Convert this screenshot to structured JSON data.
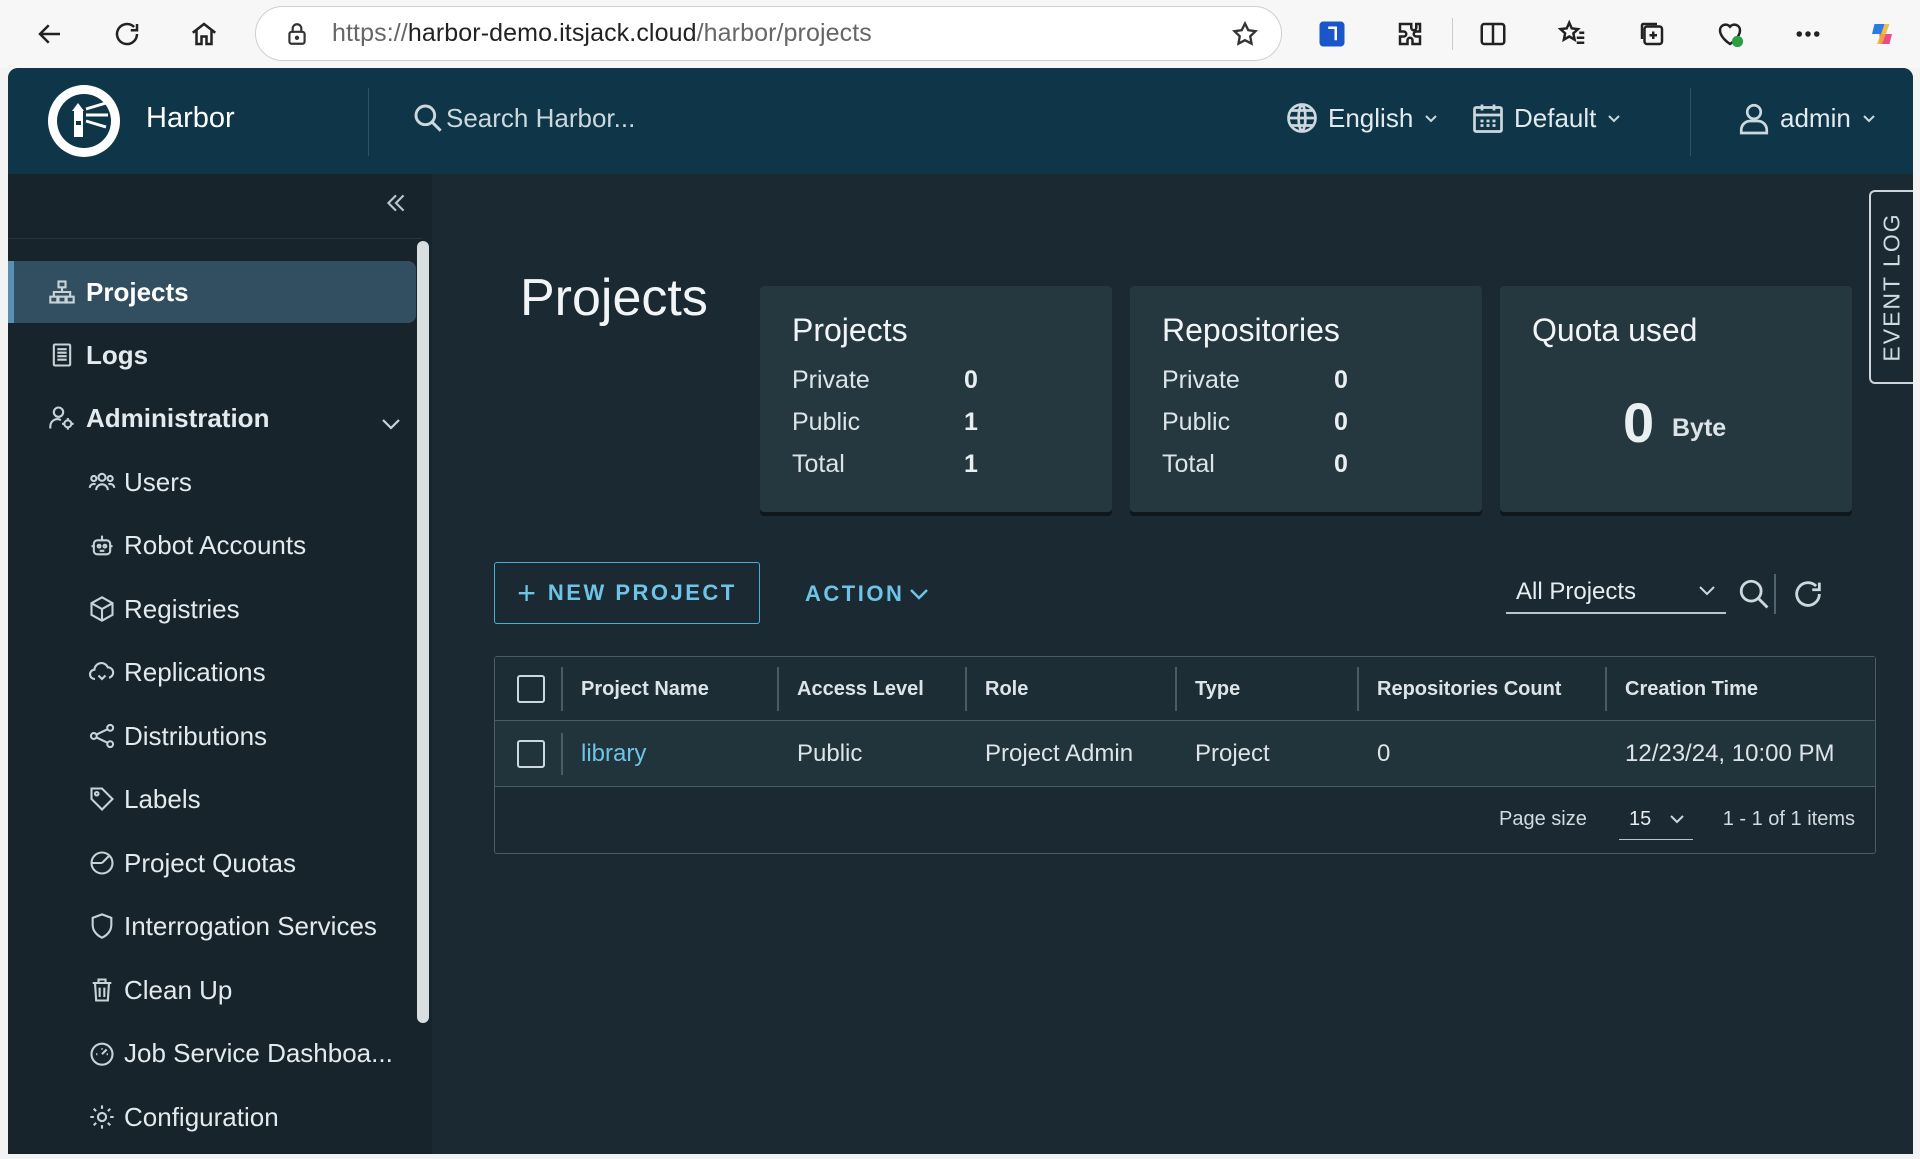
{
  "browser": {
    "url_protocol": "https://",
    "url_host": "harbor-demo.itsjack.cloud",
    "url_path": "/harbor/projects"
  },
  "header": {
    "brand": "Harbor",
    "search_placeholder": "Search Harbor...",
    "language": "English",
    "theme": "Default",
    "user": "admin"
  },
  "sidebar": {
    "items": [
      {
        "label": "Projects",
        "icon": "projects-icon",
        "active": true
      },
      {
        "label": "Logs",
        "icon": "logs-icon"
      },
      {
        "label": "Administration",
        "icon": "administration-icon",
        "expanded": true
      }
    ],
    "admin_items": [
      {
        "label": "Users",
        "icon": "users-icon"
      },
      {
        "label": "Robot Accounts",
        "icon": "robot-icon"
      },
      {
        "label": "Registries",
        "icon": "registries-icon"
      },
      {
        "label": "Replications",
        "icon": "replications-icon"
      },
      {
        "label": "Distributions",
        "icon": "distributions-icon"
      },
      {
        "label": "Labels",
        "icon": "labels-icon"
      },
      {
        "label": "Project Quotas",
        "icon": "quota-icon"
      },
      {
        "label": "Interrogation Services",
        "icon": "shield-icon"
      },
      {
        "label": "Clean Up",
        "icon": "trash-icon"
      },
      {
        "label": "Job Service Dashboa...",
        "icon": "dashboard-icon"
      },
      {
        "label": "Configuration",
        "icon": "gear-icon"
      }
    ]
  },
  "event_log": "EVENT LOG",
  "main": {
    "title": "Projects",
    "cards": {
      "projects": {
        "title": "Projects",
        "private_label": "Private",
        "private": "0",
        "public_label": "Public",
        "public": "1",
        "total_label": "Total",
        "total": "1"
      },
      "repositories": {
        "title": "Repositories",
        "private_label": "Private",
        "private": "0",
        "public_label": "Public",
        "public": "0",
        "total_label": "Total",
        "total": "0"
      },
      "quota": {
        "title": "Quota used",
        "value": "0",
        "unit": "Byte"
      }
    },
    "new_project": "NEW PROJECT",
    "action": "ACTION",
    "filter": "All Projects",
    "table": {
      "columns": [
        "Project Name",
        "Access Level",
        "Role",
        "Type",
        "Repositories Count",
        "Creation Time"
      ],
      "rows": [
        {
          "name": "library",
          "access": "Public",
          "role": "Project Admin",
          "type": "Project",
          "repos": "0",
          "created": "12/23/24, 10:00 PM"
        }
      ],
      "page_size_label": "Page size",
      "page_size": "15",
      "pagination_info": "1 - 1 of 1 items"
    }
  },
  "colors": {
    "header_bg": "#0f3548",
    "sidebar_bg": "#17242b",
    "main_bg": "#1b2a32",
    "card_bg": "#253840",
    "accent": "#6ec4e6",
    "active_nav": "#324f61"
  }
}
